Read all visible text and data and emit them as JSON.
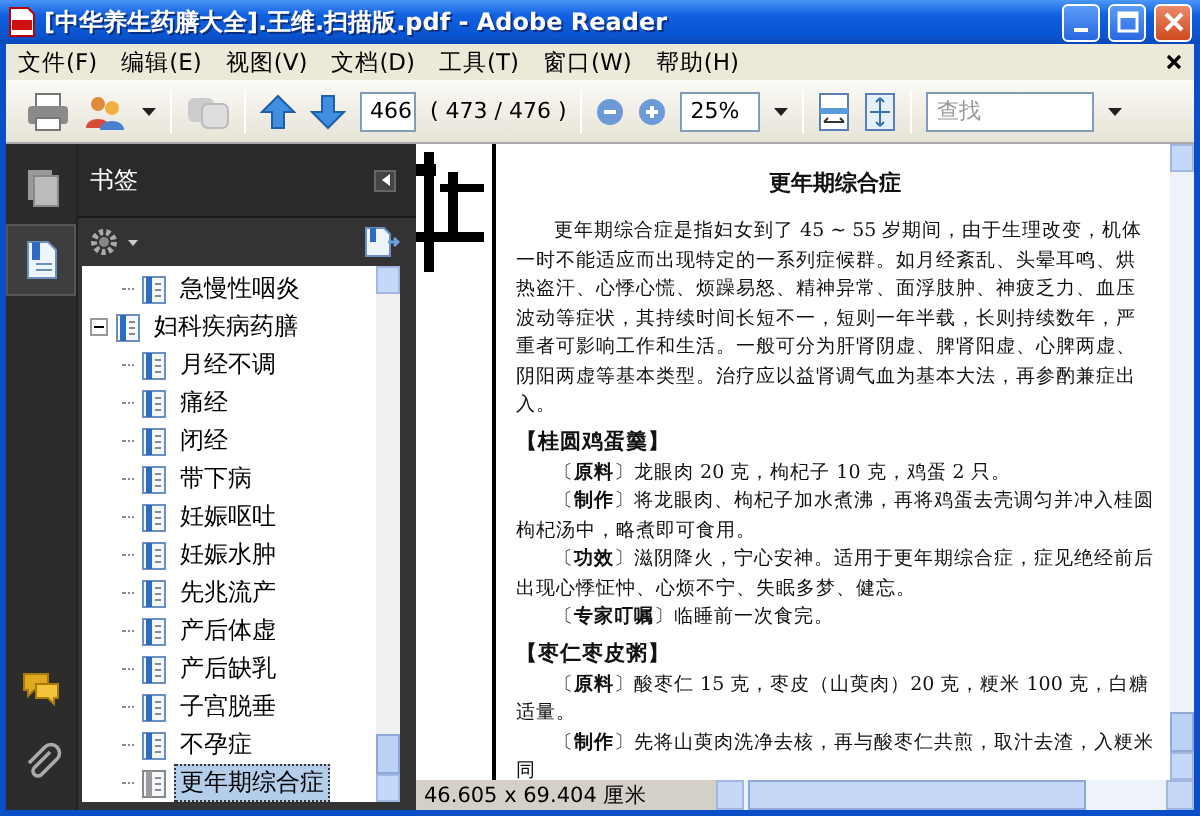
{
  "window": {
    "title": "[中华养生药膳大全].王维.扫描版.pdf - Adobe Reader"
  },
  "menu": [
    "文件(F)",
    "编辑(E)",
    "视图(V)",
    "文档(D)",
    "工具(T)",
    "窗口(W)",
    "帮助(H)"
  ],
  "toolbar": {
    "page": "466",
    "page_count": "( 473 / 476 )",
    "zoom": "25%",
    "search": {
      "placeholder": "查找"
    }
  },
  "side_rail": {
    "top": [
      {
        "kind": "pages",
        "selected": false
      },
      {
        "kind": "bookmarks",
        "selected": true
      }
    ],
    "bottom": [
      {
        "kind": "comments",
        "selected": false
      },
      {
        "kind": "attachments",
        "selected": false
      }
    ]
  },
  "bookmarks_panel": {
    "title": "书签",
    "tree": [
      {
        "children": [
          {
            "label": "急慢性咽炎",
            "selected": false
          }
        ]
      },
      {
        "label": "妇科疾病药膳",
        "selected": false,
        "expanded": true,
        "children": [
          {
            "label": "月经不调",
            "selected": false
          },
          {
            "label": "痛经",
            "selected": false
          },
          {
            "label": "闭经",
            "selected": false
          },
          {
            "label": "带下病",
            "selected": false
          },
          {
            "label": "妊娠呕吐",
            "selected": false
          },
          {
            "label": "妊娠水肿",
            "selected": false
          },
          {
            "label": "先兆流产",
            "selected": false
          },
          {
            "label": "产后体虚",
            "selected": false
          },
          {
            "label": "产后缺乳",
            "selected": false
          },
          {
            "label": "子宫脱垂",
            "selected": false
          },
          {
            "label": "不孕症",
            "selected": false
          },
          {
            "label": "更年期综合症",
            "selected": true
          }
        ]
      }
    ]
  },
  "document": {
    "title": "更年期综合症",
    "blocks": [
      {
        "kind": "para",
        "text": "更年期综合症是指妇女到了 45 ~ 55 岁期间，由于生理改变，机体一时不能适应而出现特定的一系列症候群。如月经紊乱、头晕耳鸣、烘热盗汗、心悸心慌、烦躁易怒、精神异常、面浮肢肿、神疲乏力、血压波动等症状，其持续时间长短不一，短则一年半载，长则持续数年，严重者可影响工作和生活。一般可分为肝肾阴虚、脾肾阳虚、心脾两虚、阴阳两虚等基本类型。治疗应以益肾调气血为基本大法，再参酌兼症出入。"
      },
      {
        "kind": "heading",
        "text": "【桂圆鸡蛋羹】"
      },
      {
        "kind": "para",
        "text": "〔**原料**〕龙眼肉 20 克，枸杞子 10 克，鸡蛋 2 只。"
      },
      {
        "kind": "para",
        "text": "〔**制作**〕将龙眼肉、枸杞子加水煮沸，再将鸡蛋去壳调匀并冲入桂圆枸杞汤中，略煮即可食用。"
      },
      {
        "kind": "para",
        "text": "〔**功效**〕滋阴降火，宁心安神。适用于更年期综合症，症见绝经前后出现心悸怔忡、心烦不宁、失眠多梦、健忘。"
      },
      {
        "kind": "para",
        "text": "〔**专家叮嘱**〕临睡前一次食完。"
      },
      {
        "kind": "heading",
        "text": "【枣仁枣皮粥】"
      },
      {
        "kind": "para",
        "text": "〔**原料**〕酸枣仁 15 克，枣皮（山萸肉）20 克，粳米 100 克，白糖适量。"
      },
      {
        "kind": "para",
        "text": "〔**制作**〕先将山萸肉洗净去核，再与酸枣仁共煎，取汁去渣，入粳米同"
      }
    ]
  },
  "status_bar": {
    "page_size": "46.605 x 69.404 厘米"
  }
}
